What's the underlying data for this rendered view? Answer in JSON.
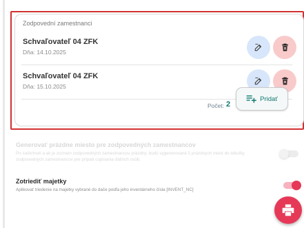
{
  "employees_card": {
    "title": "Zodpovední zamestnanci",
    "items": [
      {
        "name": "Schvaľovateľ 04 ZFK",
        "date": "Dňa: 14.10.2025"
      },
      {
        "name": "Schvaľovateľ 04 ZFK",
        "date": "Dňa: 15.10.2025"
      }
    ],
    "count_label": "Počet:",
    "count_value": "2",
    "add_label": "Pridať"
  },
  "settings": [
    {
      "title": "Generovať prázdne miesto pre zodpovedných zamestnancov",
      "description": "Po zaškrtnutí a ak je zoznam zodpovedných zamestnancov prázdny, budú vygenerované 5 prázdnych miest do tabuľky zodpovedných zamestnancov pre prípad copisania ďalších osôb.",
      "enabled": false,
      "checked": false
    },
    {
      "title": "Zotriediť majetky",
      "description": "Aplikovať triedenie na majetky vybrané do dače podľa jeho inventárneho čísla [INVENT_NC]",
      "enabled": true,
      "checked": true
    }
  ],
  "colors": {
    "accent_teal": "#0f7a71",
    "fab": "#e53957",
    "toggle_on": "#e53957",
    "highlight_border": "#d32f2f"
  },
  "icons": {
    "edit": "edit-icon",
    "delete": "trash-icon",
    "add": "playlist-add-icon",
    "print": "print-icon"
  }
}
